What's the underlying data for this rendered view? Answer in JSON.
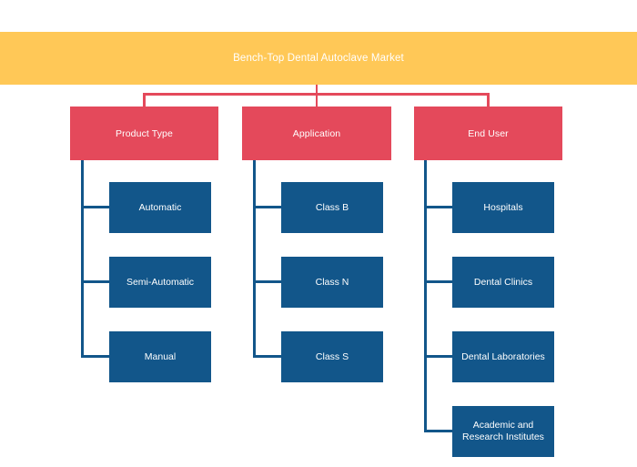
{
  "root": {
    "label": "Bench-Top Dental Autoclave Market",
    "color": "#ffc857",
    "text_color": "#ffffff"
  },
  "colors": {
    "root_banner": "#ffc857",
    "category_box": "#e4495b",
    "leaf_box": "#12568a",
    "connector_red": "#e4495b",
    "connector_blue": "#12568a",
    "background": "#ffffff",
    "label_text": "#ffffff"
  },
  "categories": [
    {
      "label": "Product Type",
      "children": [
        {
          "label": "Automatic"
        },
        {
          "label": "Semi-Automatic"
        },
        {
          "label": "Manual"
        }
      ]
    },
    {
      "label": "Application",
      "children": [
        {
          "label": "Class B"
        },
        {
          "label": "Class   N"
        },
        {
          "label": "Class S"
        }
      ]
    },
    {
      "label": "End User",
      "children": [
        {
          "label": "Hospitals"
        },
        {
          "label": "Dental Clinics"
        },
        {
          "label": "Dental Laboratories"
        },
        {
          "label": "Academic and Research Institutes"
        }
      ]
    }
  ]
}
